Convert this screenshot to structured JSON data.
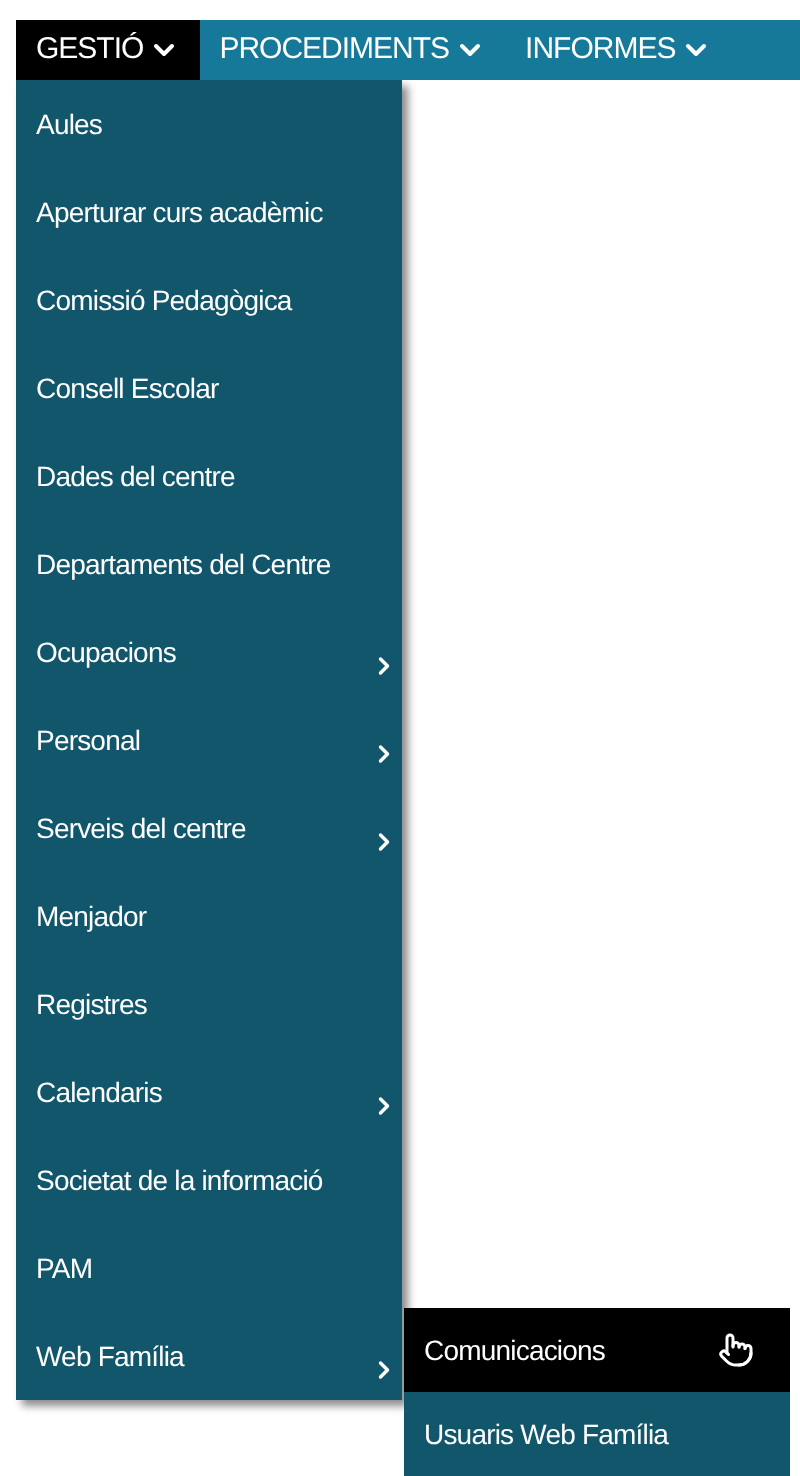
{
  "menubar": [
    {
      "label": "GESTIÓ",
      "selected": true
    },
    {
      "label": "PROCEDIMENTS",
      "selected": false
    },
    {
      "label": "INFORMES",
      "selected": false
    }
  ],
  "menu": [
    {
      "label": "Aules",
      "has_submenu": false
    },
    {
      "label": "Aperturar curs acadèmic",
      "has_submenu": false
    },
    {
      "label": "Comissió Pedagògica",
      "has_submenu": false
    },
    {
      "label": "Consell Escolar",
      "has_submenu": false
    },
    {
      "label": "Dades del centre",
      "has_submenu": false
    },
    {
      "label": "Departaments del Centre",
      "has_submenu": false
    },
    {
      "label": "Ocupacions",
      "has_submenu": true
    },
    {
      "label": "Personal",
      "has_submenu": true
    },
    {
      "label": "Serveis del centre",
      "has_submenu": true
    },
    {
      "label": "Menjador",
      "has_submenu": false
    },
    {
      "label": "Registres",
      "has_submenu": false
    },
    {
      "label": "Calendaris",
      "has_submenu": true
    },
    {
      "label": "Societat de la informació",
      "has_submenu": false
    },
    {
      "label": "PAM",
      "has_submenu": false
    },
    {
      "label": "Web Família",
      "has_submenu": true,
      "children": [
        {
          "label": "Comunicacions",
          "selected": true
        },
        {
          "label": "Usuaris Web Família",
          "selected": false
        }
      ]
    }
  ]
}
